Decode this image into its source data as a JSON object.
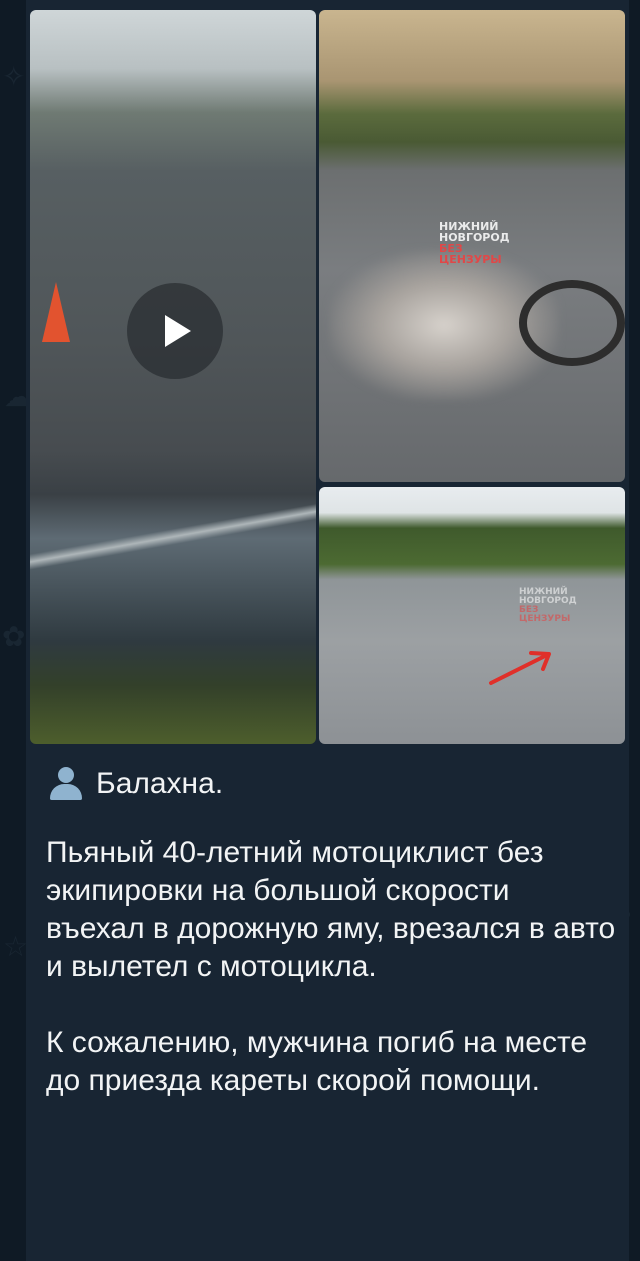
{
  "post": {
    "location": "Балахна.",
    "paragraph1": "Пьяный 40-летний мотоциклист без экипировки на большой скорости въехал в дорожную яму, врезался в авто и вылетел с мотоцикла.",
    "paragraph2": "К сожалению, мужчина погиб на месте до приезда кареты скорой помощи."
  },
  "media": {
    "video_icon": "play-icon",
    "watermark_line1": "НИЖНИЙ",
    "watermark_line2": "НОВГОРОД",
    "watermark_line3": "БЕЗ",
    "watermark_line4": "ЦЕНЗУРЫ"
  },
  "colors": {
    "bubble_bg": "#182533",
    "text": "#f2f4f5",
    "icon": "#8fb3cf"
  },
  "icons": {
    "location": "person-silhouette-icon"
  }
}
